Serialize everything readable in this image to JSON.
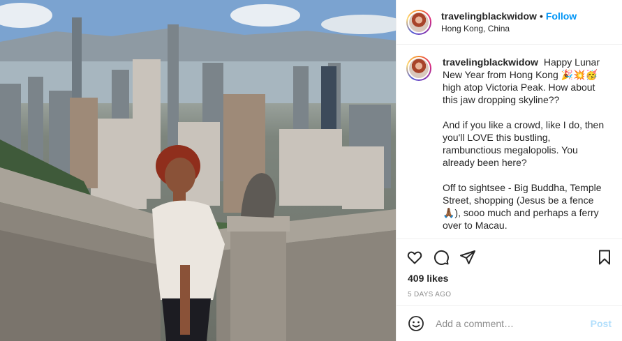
{
  "post": {
    "username": "travelingblackwidow",
    "separator": "•",
    "follow_label": "Follow",
    "location": "Hong Kong, China"
  },
  "caption": {
    "username": "travelingblackwidow",
    "paragraph_1": "Happy Lunar New Year from Hong Kong 🎉💥🥳 high atop Victoria Peak. How about this jaw dropping skyline??",
    "paragraph_2": "And if you like a crowd, like I do, then you'll LOVE this bustling, rambunctious megalopolis. You already been here?",
    "paragraph_3": "Off to sightsee - Big Buddha, Temple Street, shopping (Jesus be a fence🙏🏾), sooo much and perhaps a ferry over to Macau."
  },
  "engagement": {
    "likes": "409 likes",
    "timestamp": "5 DAYS AGO"
  },
  "comment_box": {
    "placeholder": "Add a comment…",
    "post_label": "Post"
  },
  "icons": {
    "like": "heart-icon",
    "comment": "comment-icon",
    "share": "paper-plane-icon",
    "save": "bookmark-icon",
    "emoji": "smiley-icon"
  },
  "colors": {
    "accent": "#0095f6",
    "post_disabled": "#b2dffc",
    "muted": "#8e8e8e",
    "border": "#efefef"
  }
}
